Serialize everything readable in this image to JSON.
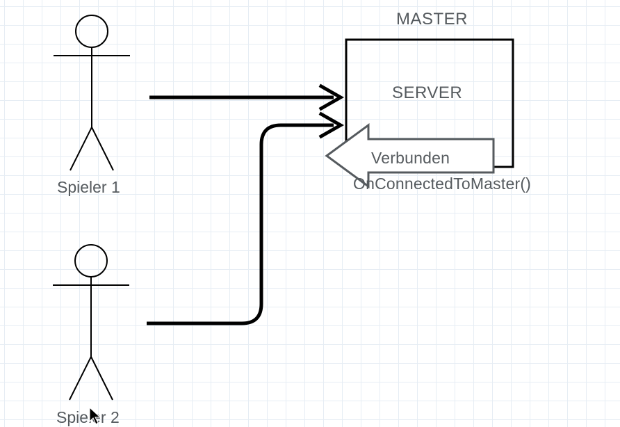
{
  "labels": {
    "master": "MASTER",
    "server": "SERVER",
    "verbunden": "Verbunden",
    "onconnected": "OnConnectedToMaster()",
    "player1": "Spieler 1",
    "player2": "Spieler 2"
  }
}
